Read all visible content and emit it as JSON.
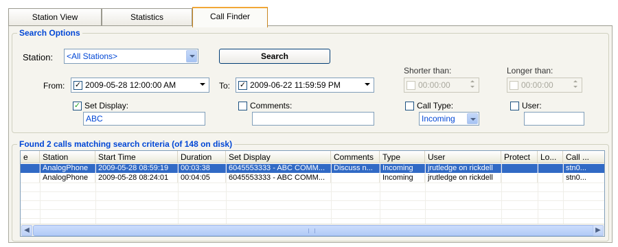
{
  "tabs": [
    {
      "label": "Station View",
      "active": false
    },
    {
      "label": "Statistics",
      "active": false
    },
    {
      "label": "Call Finder",
      "active": true
    }
  ],
  "search_options": {
    "title": "Search Options",
    "station_label": "Station:",
    "station_value": "<All Stations>",
    "search_button": "Search",
    "from_label": "From:",
    "from_value": "2009-05-28 12:00:00 AM",
    "from_checked": true,
    "to_label": "To:",
    "to_value": "2009-06-22 11:59:59 PM",
    "to_checked": true,
    "shorter_label": "Shorter than:",
    "shorter_value": "00:00:00",
    "longer_label": "Longer than:",
    "longer_value": "00:00:00",
    "set_display_label": "Set Display:",
    "set_display_checked": true,
    "set_display_value": "ABC",
    "comments_label": "Comments:",
    "comments_checked": false,
    "comments_value": "",
    "call_type_label": "Call Type:",
    "call_type_checked": false,
    "call_type_value": "Incoming",
    "user_label": "User:",
    "user_checked": false,
    "user_value": ""
  },
  "results": {
    "title": "Found 2 calls matching search criteria (of 148 on disk)",
    "columns": [
      "e",
      "Station",
      "Start Time",
      "Duration",
      "Set Display",
      "Comments",
      "Type",
      "User",
      "Protect",
      "Lo...",
      "Call ..."
    ],
    "rows": [
      {
        "selected": true,
        "cells": [
          "",
          "AnalogPhone",
          "2009-05-28 08:59:19",
          "00:03:38",
          "6045553333 - ABC COMM...",
          "Discuss n...",
          "Incoming",
          "jrutledge on rickdell",
          "",
          "",
          "stn0..."
        ]
      },
      {
        "selected": false,
        "cells": [
          "",
          "AnalogPhone",
          "2009-05-28 08:24:01",
          "00:04:05",
          "6045553333 - ABC COMM...",
          "",
          "Incoming",
          "jrutledge on rickdell",
          "",
          "",
          "stn0..."
        ]
      }
    ]
  },
  "colors": {
    "group_title": "#0046d5",
    "selection": "#316ac5",
    "active_tab_accent": "#f2a736"
  },
  "icons": {
    "dropdown": "chevron-down-icon",
    "scroll_left": "arrow-left-icon",
    "scroll_right": "arrow-right-icon"
  }
}
